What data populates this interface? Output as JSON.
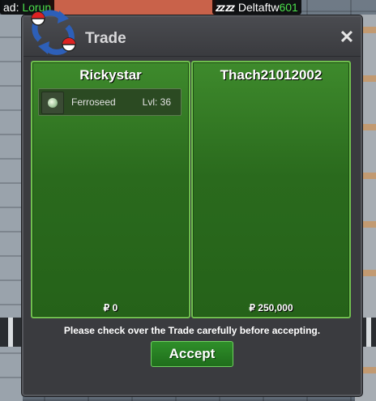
{
  "hud": {
    "left_prefix": "ad:",
    "left_name": "Lorun",
    "right_name": "Deltaftw",
    "right_suffix": "601"
  },
  "window": {
    "title": "Trade",
    "close_label": "✕"
  },
  "panels": [
    {
      "player": "Rickystar",
      "items": [
        {
          "pokemon": "Ferroseed",
          "level": "Lvl: 36",
          "icon": "ferroseed-icon"
        }
      ],
      "money": "₽ 0"
    },
    {
      "player": "Thach21012002",
      "items": [],
      "money": "₽ 250,000"
    }
  ],
  "notice": "Please check over the Trade carefully before accepting.",
  "accept_label": "Accept",
  "colors": {
    "panel_green": "#2f7421",
    "panel_border": "#6fbf4e",
    "accept_green": "#2a8526",
    "window_bg": "#3a3b3f",
    "name_highlight": "#4be04b"
  }
}
